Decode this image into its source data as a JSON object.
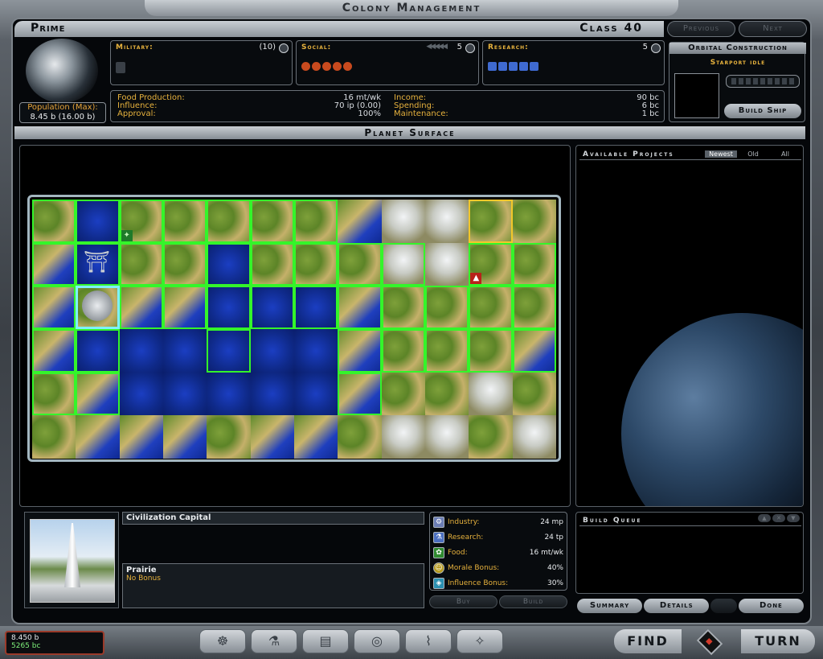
{
  "window": {
    "title": "Colony Management"
  },
  "colony": {
    "name": "Prime",
    "class": "Class 40",
    "population_label": "Population (Max):",
    "population_value": "8.45 b (16.00 b)"
  },
  "nav": {
    "previous": "Previous",
    "next": "Next"
  },
  "stats": {
    "military": {
      "label": "Military:",
      "value": "(10)"
    },
    "social": {
      "label": "Social:",
      "arrows": "◀◀◀◀◀",
      "value": "5"
    },
    "research": {
      "label": "Research:",
      "value": "5"
    }
  },
  "economy": {
    "food_label": "Food Production:",
    "food_value": "16 mt/wk",
    "influence_label": "Influence:",
    "influence_value": "70 ip (0.00)",
    "approval_label": "Approval:",
    "approval_value": "100%",
    "income_label": "Income:",
    "income_value": "90 bc",
    "spending_label": "Spending:",
    "spending_value": "6 bc",
    "maintenance_label": "Maintenance:",
    "maintenance_value": "1 bc"
  },
  "orbital": {
    "title": "Orbital Construction",
    "status": "Starport idle",
    "build_ship": "Build Ship"
  },
  "surface": {
    "title": "Planet Surface"
  },
  "projects": {
    "title": "Available Projects",
    "filters": [
      "Newest",
      "Old",
      "All"
    ]
  },
  "build_queue": {
    "title": "Build Queue",
    "controls": [
      "▲",
      "✕",
      "▼"
    ]
  },
  "selected_tile": {
    "improvement": "Civilization Capital",
    "terrain": "Prairie",
    "bonus": "No Bonus"
  },
  "yields": [
    {
      "label": "Industry:",
      "value": "24 mp",
      "icon": "gear-icon",
      "color": "#6b7db5"
    },
    {
      "label": "Research:",
      "value": "24 tp",
      "icon": "flask-icon",
      "color": "#4b6fc0"
    },
    {
      "label": "Food:",
      "value": "16 mt/wk",
      "icon": "leaf-icon",
      "color": "#2f8a2f"
    },
    {
      "label": "Morale Bonus:",
      "value": "40%",
      "icon": "smiley-icon",
      "color": "#b69a1f"
    },
    {
      "label": "Influence Bonus:",
      "value": "30%",
      "icon": "influence-icon",
      "color": "#2a8fb0"
    }
  ],
  "actions": {
    "buy": "Buy",
    "build": "Build"
  },
  "tabs": {
    "summary": "Summary",
    "details": "Details",
    "done": "Done"
  },
  "treasury": {
    "population": "8.450 b",
    "credits": "5265 bc"
  },
  "bottom": {
    "find": "FIND",
    "turn": "TURN",
    "icons": [
      "government-icon",
      "research-icon",
      "planets-icon",
      "galaxy-icon",
      "graph-icon",
      "diplomacy-icon"
    ]
  },
  "colors": {
    "accent": "#e7b23d",
    "owned_tile": "#34f52a",
    "selected_tile": "#7ef2ff"
  }
}
